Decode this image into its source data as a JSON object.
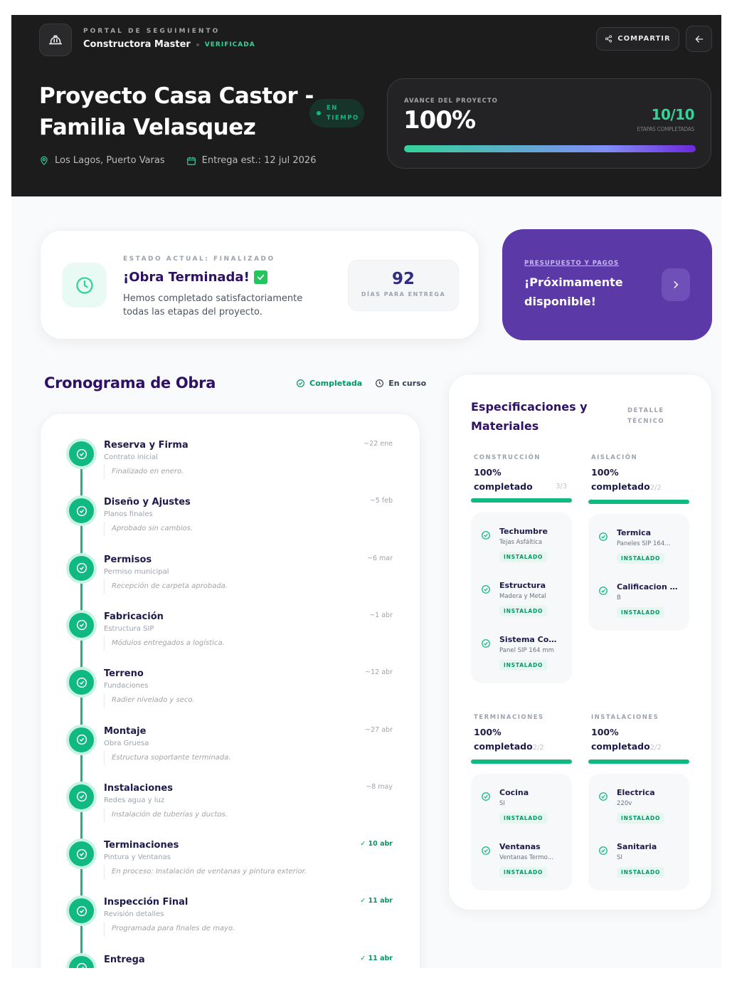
{
  "header": {
    "portal_label": "PORTAL DE SEGUIMIENTO",
    "company": "Constructora Master",
    "verified": "VERIFICADA",
    "share_label": "COMPARTIR",
    "title": "Proyecto Casa Castor - Familia Velasquez",
    "status_pill": "EN TIEMPO",
    "location": "Los Lagos, Puerto Varas",
    "delivery": "Entrega est.: 12 jul 2026"
  },
  "progress": {
    "label": "AVANCE DEL PROYECTO",
    "value": "100%",
    "fraction": 1.0,
    "stages": "10/10",
    "stages_label": "ETAPAS COMPLETADAS"
  },
  "status_card": {
    "label": "ESTADO ACTUAL: FINALIZADO",
    "title": "¡Obra Terminada!",
    "description": "Hemos completado satisfactoriamente todas las etapas del proyecto.",
    "days": "92",
    "days_label": "DÍAS PARA ENTREGA"
  },
  "budget_card": {
    "label": "PRESUPUESTO Y PAGOS",
    "text": "¡Próximamente disponible!"
  },
  "timeline": {
    "heading": "Cronograma de Obra",
    "legend_done": "Completada",
    "legend_current": "En curso",
    "items": [
      {
        "title": "Reserva y Firma",
        "sub": "Contrato inicial",
        "note": "Finalizado en enero.",
        "date": "~22 ene",
        "done": false
      },
      {
        "title": "Diseño y Ajustes",
        "sub": "Planos finales",
        "note": "Aprobado sin cambios.",
        "date": "~5 feb",
        "done": false
      },
      {
        "title": "Permisos",
        "sub": "Permiso municipal",
        "note": "Recepción de carpeta aprobada.",
        "date": "~6 mar",
        "done": false
      },
      {
        "title": "Fabricación",
        "sub": "Estructura SIP",
        "note": "Módulos entregados a logística.",
        "date": "~1 abr",
        "done": false
      },
      {
        "title": "Terreno",
        "sub": "Fundaciones",
        "note": "Radier nivelado y seco.",
        "date": "~12 abr",
        "done": false
      },
      {
        "title": "Montaje",
        "sub": "Obra Gruesa",
        "note": "Estructura soportante terminada.",
        "date": "~27 abr",
        "done": false
      },
      {
        "title": "Instalaciones",
        "sub": "Redes agua y luz",
        "note": "Instalación de tuberías y ductos.",
        "date": "~8 may",
        "done": false
      },
      {
        "title": "Terminaciones",
        "sub": "Pintura y Ventanas",
        "note": "En proceso: Instalación de ventanas y pintura exterior.",
        "date": "✓ 10 abr",
        "done": true
      },
      {
        "title": "Inspección Final",
        "sub": "Revisión detalles",
        "note": "Programada para finales de mayo.",
        "date": "✓ 11 abr",
        "done": true
      },
      {
        "title": "Entrega",
        "sub": "",
        "note": "",
        "date": "✓ 11 abr",
        "done": true
      }
    ]
  },
  "specs": {
    "title": "Especificaciones y Materiales",
    "tag": "DETALLE TÉCNICO",
    "installed_label": "INSTALADO",
    "categories": [
      {
        "label": "CONSTRUCCIÓN",
        "status": "100% completado",
        "count": "3/3",
        "items": [
          {
            "name": "Techumbre",
            "sub": "Tejas Asfáltica"
          },
          {
            "name": "Estructura",
            "sub": "Madera y Metal"
          },
          {
            "name": "Sistema Cons...",
            "sub": "Panel SIP 164 mm"
          }
        ]
      },
      {
        "label": "AISLACIÓN",
        "status": "100% completado",
        "count": "2/2",
        "items": [
          {
            "name": "Termica",
            "sub": "Paneles SIP 164..."
          },
          {
            "name": "Calificacion E...",
            "sub": "B"
          }
        ]
      },
      {
        "label": "TERMINACIONES",
        "status": "100% completado",
        "count": "2/2",
        "items": [
          {
            "name": "Cocina",
            "sub": "SI"
          },
          {
            "name": "Ventanas",
            "sub": "Ventanas Termo..."
          }
        ]
      },
      {
        "label": "INSTALACIONES",
        "status": "100% completado",
        "count": "2/2",
        "items": [
          {
            "name": "Electrica",
            "sub": "220v"
          },
          {
            "name": "Sanitaria",
            "sub": "SI"
          }
        ]
      }
    ]
  },
  "colors": {
    "accent": "#10b981",
    "purple": "#5b3aa8",
    "dark": "#1c1c1d"
  }
}
